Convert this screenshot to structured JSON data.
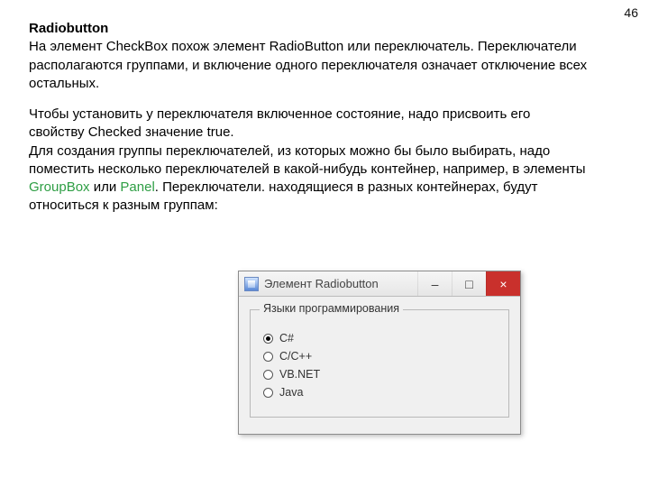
{
  "page_number": "46",
  "heading": "Radiobutton",
  "para1": "На элемент CheckBox похож элемент RadioButton или переключатель. Переключатели располагаются группами, и включение одного переключателя означает отключение всех остальных.",
  "para2a": "Чтобы установить у переключателя включенное состояние, надо присвоить его свойству Checked значение true.",
  "para2b_prefix": "Для создания группы переключателей, из которых можно бы было выбирать, надо поместить несколько переключателей в какой-нибудь контейнер, например, в элементы ",
  "kw1": "GroupBox",
  "para2b_mid": " или ",
  "kw2": "Panel",
  "para2b_suffix": ". Переключатели. находящиеся в разных контейнерах, будут относиться к разным группам:",
  "window": {
    "title": "Элемент Radiobutton",
    "min_glyph": "–",
    "max_glyph": "□",
    "close_glyph": "×",
    "group_legend": "Языки программирования",
    "options": [
      {
        "label": "C#",
        "checked": true
      },
      {
        "label": "C/C++",
        "checked": false
      },
      {
        "label": "VB.NET",
        "checked": false
      },
      {
        "label": "Java",
        "checked": false
      }
    ]
  }
}
